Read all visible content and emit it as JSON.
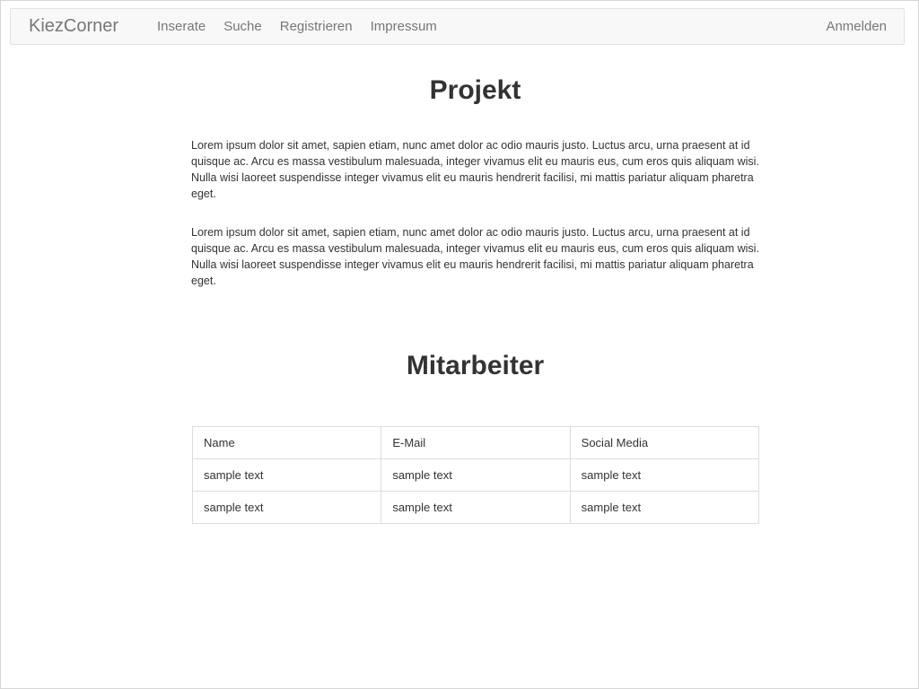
{
  "navbar": {
    "brand": "KiezCorner",
    "links": [
      "Inserate",
      "Suche",
      "Registrieren",
      "Impressum"
    ],
    "login": "Anmelden"
  },
  "project": {
    "title": "Projekt",
    "paragraphs": [
      "Lorem ipsum dolor sit amet, sapien etiam, nunc amet dolor ac odio mauris justo. Luctus arcu, urna praesent at id quisque ac. Arcu es massa vestibulum malesuada, integer vivamus elit eu mauris eus, cum eros quis aliquam wisi. Nulla wisi laoreet suspendisse integer vivamus elit eu mauris hendrerit facilisi, mi mattis pariatur aliquam pharetra eget.",
      "Lorem ipsum dolor sit amet, sapien etiam, nunc amet dolor ac odio mauris justo. Luctus arcu, urna praesent at id quisque ac. Arcu es massa vestibulum malesuada, integer vivamus elit eu mauris eus, cum eros quis aliquam wisi. Nulla wisi laoreet suspendisse integer vivamus elit eu mauris hendrerit facilisi, mi mattis pariatur aliquam pharetra eget."
    ]
  },
  "staff": {
    "title": "Mitarbeiter",
    "headers": [
      "Name",
      "E-Mail",
      "Social Media"
    ],
    "rows": [
      [
        "sample text",
        "sample text",
        "sample text"
      ],
      [
        "sample text",
        "sample text",
        "sample text"
      ]
    ]
  }
}
